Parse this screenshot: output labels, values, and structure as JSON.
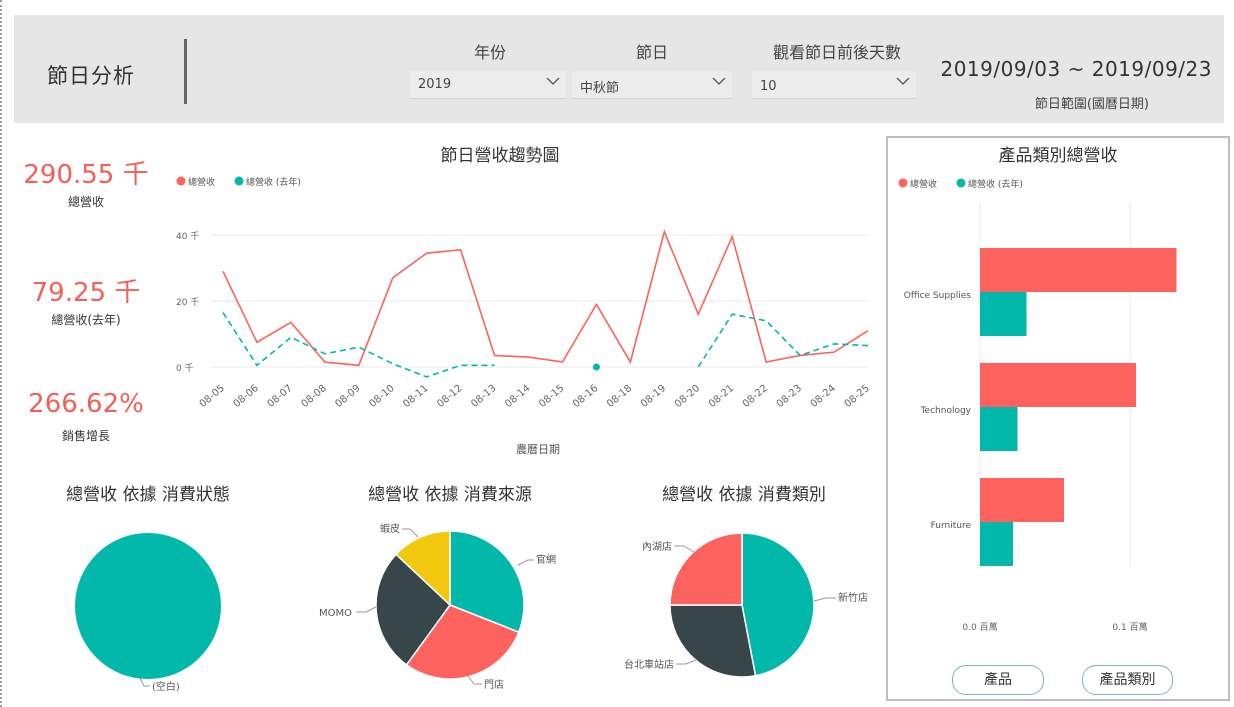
{
  "header": {
    "title": "節日分析",
    "slicers": [
      {
        "label": "年份",
        "value": "2019"
      },
      {
        "label": "節日",
        "value": "中秋節"
      },
      {
        "label": "觀看節日前後天數",
        "value": "10"
      }
    ],
    "date_range": "2019/09/03 ~ 2019/09/23",
    "date_range_label": "節日範圍(國曆日期)"
  },
  "kpis": [
    {
      "value": "290.55 千",
      "label": "總營收"
    },
    {
      "value": "79.25 千",
      "label": "總營收(去年)"
    },
    {
      "value": "266.62%",
      "label": "銷售增長"
    }
  ],
  "colors": {
    "primary": "#fd625e",
    "secondary": "#01b8aa",
    "dark": "#374649",
    "yellow": "#f2c80f"
  },
  "buttons": {
    "product": "產品",
    "category": "產品類別"
  },
  "chart_data": [
    {
      "type": "line",
      "title": "節日營收趨勢圖",
      "xlabel": "農曆日期",
      "ylabel": "",
      "categories": [
        "08-05",
        "08-06",
        "08-07",
        "08-08",
        "08-09",
        "08-10",
        "08-11",
        "08-12",
        "08-13",
        "08-14",
        "08-15",
        "08-16",
        "08-18",
        "08-19",
        "08-20",
        "08-21",
        "08-22",
        "08-23",
        "08-24",
        "08-25"
      ],
      "yticks": [
        "0 千",
        "20 千",
        "40 千"
      ],
      "ylim": [
        0,
        40
      ],
      "grid": true,
      "legend_position": "top-left",
      "series": [
        {
          "name": "總營收",
          "style": "solid",
          "values": [
            29,
            7.5,
            13.5,
            1.5,
            0.5,
            27,
            34.5,
            35.5,
            3.5,
            3,
            1.5,
            19,
            1.5,
            41,
            16,
            39.5,
            1.5,
            3.5,
            4.5,
            11
          ]
        },
        {
          "name": "總營收 (去年)",
          "style": "dashed",
          "values": [
            16.5,
            0.5,
            9,
            4,
            6,
            1,
            -3,
            0.5,
            0.5,
            null,
            null,
            0,
            null,
            null,
            0,
            16,
            14,
            3.5,
            7,
            6.5
          ]
        }
      ]
    },
    {
      "type": "bar",
      "orientation": "horizontal",
      "title": "產品類別總營收",
      "categories": [
        "Office Supplies",
        "Technology",
        "Furniture"
      ],
      "xticks": [
        "0.0 百萬",
        "0.1 百萬"
      ],
      "xlim": [
        0,
        0.13
      ],
      "legend_position": "top-left",
      "series": [
        {
          "name": "總營收",
          "values": [
            0.131,
            0.104,
            0.056
          ]
        },
        {
          "name": "總營收 (去年)",
          "values": [
            0.031,
            0.025,
            0.022
          ]
        }
      ]
    },
    {
      "type": "pie",
      "title": "總營收 依據 消費狀態",
      "slices": [
        {
          "label": "(空白)",
          "value": 100
        }
      ]
    },
    {
      "type": "pie",
      "title": "總營收 依據 消費來源",
      "slices": [
        {
          "label": "官網",
          "value": 31
        },
        {
          "label": "門店",
          "value": 29
        },
        {
          "label": "MOMO",
          "value": 27
        },
        {
          "label": "蝦皮",
          "value": 13
        }
      ]
    },
    {
      "type": "pie",
      "title": "總營收 依據 消費類別",
      "slices": [
        {
          "label": "新竹店",
          "value": 47
        },
        {
          "label": "台北車站店",
          "value": 28
        },
        {
          "label": "內湖店",
          "value": 25
        }
      ]
    }
  ]
}
